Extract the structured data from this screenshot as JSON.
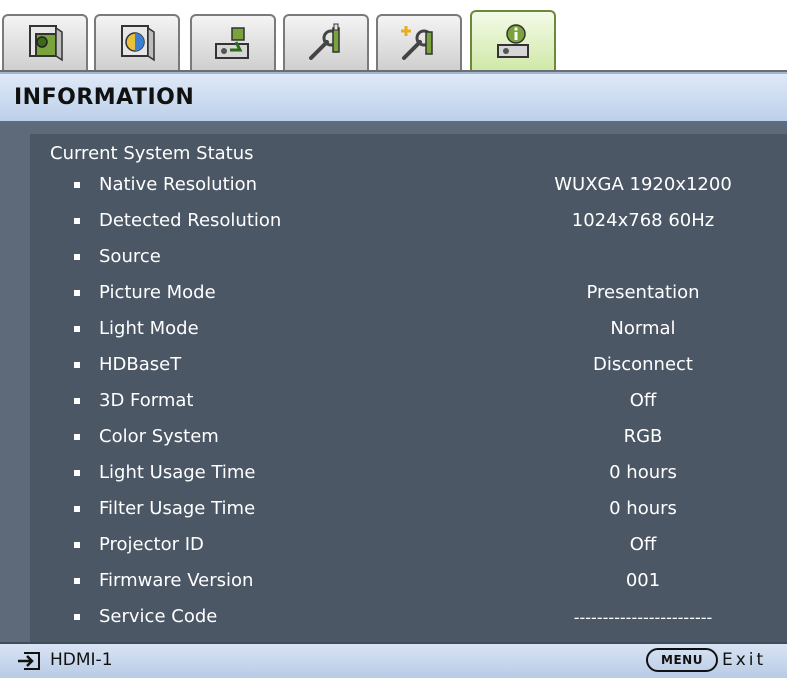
{
  "tabs": [
    {
      "icon": "picture-icon",
      "active": false
    },
    {
      "icon": "picture-advanced-icon",
      "active": false
    },
    {
      "icon": "source-icon",
      "active": false
    },
    {
      "icon": "system-setup-basic-icon",
      "active": false
    },
    {
      "icon": "system-setup-advanced-icon",
      "active": false
    },
    {
      "icon": "information-icon",
      "active": true
    }
  ],
  "header": {
    "title": "INFORMATION"
  },
  "main": {
    "section_title": "Current System Status",
    "rows": [
      {
        "label": "Native Resolution",
        "value": "WUXGA 1920x1200"
      },
      {
        "label": "Detected Resolution",
        "value": "1024x768 60Hz"
      },
      {
        "label": "Source",
        "value": ""
      },
      {
        "label": "Picture Mode",
        "value": "Presentation"
      },
      {
        "label": "Light Mode",
        "value": "Normal"
      },
      {
        "label": "HDBaseT",
        "value": "Disconnect"
      },
      {
        "label": "3D Format",
        "value": "Off"
      },
      {
        "label": "Color System",
        "value": "RGB"
      },
      {
        "label": "Light Usage Time",
        "value": "0 hours"
      },
      {
        "label": "Filter Usage Time",
        "value": "0 hours"
      },
      {
        "label": "Projector ID",
        "value": "Off"
      },
      {
        "label": "Firmware Version",
        "value": "001"
      },
      {
        "label": "Service Code",
        "value": "------------------------"
      }
    ]
  },
  "footer": {
    "source_label": "HDMI-1",
    "menu_button": "MENU",
    "exit_label": "Exit"
  },
  "colors": {
    "panel_bg": "#4c5766",
    "header_bg": "#c9d9ef",
    "active_tab": "#cfe8a6"
  }
}
